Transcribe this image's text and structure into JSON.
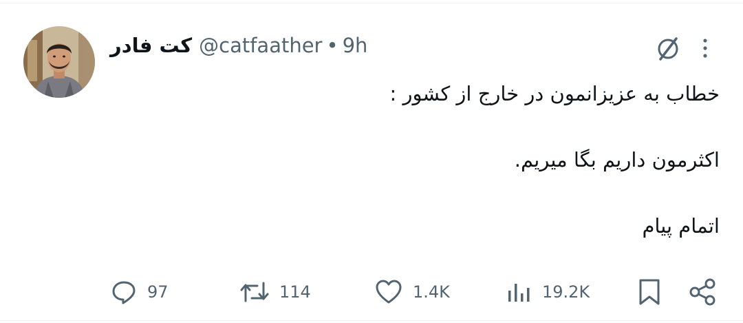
{
  "tweet": {
    "author": {
      "display_name": "کت فادر",
      "handle": "@catfaather",
      "avatar": "profile-photo"
    },
    "separator": "•",
    "time": "9h",
    "lines": [
      "خطاب به عزیزانمون در خارج از کشور :",
      "اکثرمون داریم بگا میریم.",
      "اتمام پیام"
    ],
    "icons": {
      "grok": "grok-icon",
      "more": "more-vertical-icon"
    }
  },
  "actions": {
    "reply": {
      "icon": "reply-icon",
      "count": "97"
    },
    "repost": {
      "icon": "repost-icon",
      "count": "114"
    },
    "like": {
      "icon": "heart-icon",
      "count": "1.4K"
    },
    "views": {
      "icon": "analytics-icon",
      "count": "19.2K"
    },
    "bookmark": {
      "icon": "bookmark-icon"
    },
    "share": {
      "icon": "share-icon"
    }
  },
  "colors": {
    "text": "#0f1419",
    "secondary": "#536471",
    "divider": "#eff3f4"
  }
}
